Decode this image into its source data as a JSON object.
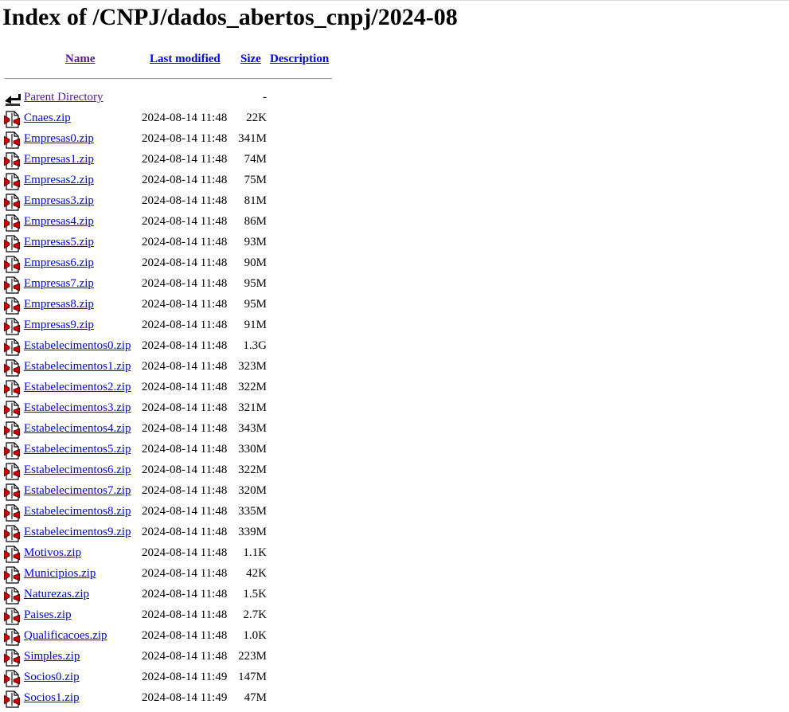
{
  "page": {
    "title": "Index of /CNPJ/dados_abertos_cnpj/2024-08"
  },
  "columns": {
    "name": "Name",
    "last_modified": "Last modified",
    "size": "Size",
    "description": "Description"
  },
  "parent": {
    "label": "Parent Directory",
    "modified": "",
    "size": "-",
    "icon": "back-arrow-icon"
  },
  "files": [
    {
      "name": "Cnaes.zip",
      "modified": "2024-08-14 11:48",
      "size": "22K"
    },
    {
      "name": "Empresas0.zip",
      "modified": "2024-08-14 11:48",
      "size": "341M"
    },
    {
      "name": "Empresas1.zip",
      "modified": "2024-08-14 11:48",
      "size": "74M"
    },
    {
      "name": "Empresas2.zip",
      "modified": "2024-08-14 11:48",
      "size": "75M"
    },
    {
      "name": "Empresas3.zip",
      "modified": "2024-08-14 11:48",
      "size": "81M"
    },
    {
      "name": "Empresas4.zip",
      "modified": "2024-08-14 11:48",
      "size": "86M"
    },
    {
      "name": "Empresas5.zip",
      "modified": "2024-08-14 11:48",
      "size": "93M"
    },
    {
      "name": "Empresas6.zip",
      "modified": "2024-08-14 11:48",
      "size": "90M"
    },
    {
      "name": "Empresas7.zip",
      "modified": "2024-08-14 11:48",
      "size": "95M"
    },
    {
      "name": "Empresas8.zip",
      "modified": "2024-08-14 11:48",
      "size": "95M"
    },
    {
      "name": "Empresas9.zip",
      "modified": "2024-08-14 11:48",
      "size": "91M"
    },
    {
      "name": "Estabelecimentos0.zip",
      "modified": "2024-08-14 11:48",
      "size": "1.3G"
    },
    {
      "name": "Estabelecimentos1.zip",
      "modified": "2024-08-14 11:48",
      "size": "323M"
    },
    {
      "name": "Estabelecimentos2.zip",
      "modified": "2024-08-14 11:48",
      "size": "322M"
    },
    {
      "name": "Estabelecimentos3.zip",
      "modified": "2024-08-14 11:48",
      "size": "321M"
    },
    {
      "name": "Estabelecimentos4.zip",
      "modified": "2024-08-14 11:48",
      "size": "343M"
    },
    {
      "name": "Estabelecimentos5.zip",
      "modified": "2024-08-14 11:48",
      "size": "330M"
    },
    {
      "name": "Estabelecimentos6.zip",
      "modified": "2024-08-14 11:48",
      "size": "322M"
    },
    {
      "name": "Estabelecimentos7.zip",
      "modified": "2024-08-14 11:48",
      "size": "320M"
    },
    {
      "name": "Estabelecimentos8.zip",
      "modified": "2024-08-14 11:48",
      "size": "335M"
    },
    {
      "name": "Estabelecimentos9.zip",
      "modified": "2024-08-14 11:48",
      "size": "339M"
    },
    {
      "name": "Motivos.zip",
      "modified": "2024-08-14 11:48",
      "size": "1.1K"
    },
    {
      "name": "Municipios.zip",
      "modified": "2024-08-14 11:48",
      "size": "42K"
    },
    {
      "name": "Naturezas.zip",
      "modified": "2024-08-14 11:48",
      "size": "1.5K"
    },
    {
      "name": "Paises.zip",
      "modified": "2024-08-14 11:48",
      "size": "2.7K"
    },
    {
      "name": "Qualificacoes.zip",
      "modified": "2024-08-14 11:48",
      "size": "1.0K"
    },
    {
      "name": "Simples.zip",
      "modified": "2024-08-14 11:48",
      "size": "223M"
    },
    {
      "name": "Socios0.zip",
      "modified": "2024-08-14 11:49",
      "size": "147M"
    },
    {
      "name": "Socios1.zip",
      "modified": "2024-08-14 11:49",
      "size": "47M"
    }
  ],
  "file_icon": "compressed-file-icon",
  "colors": {
    "link": "#0000ee",
    "visited_link": "#551a8b",
    "icon_red": "#cc0000"
  }
}
